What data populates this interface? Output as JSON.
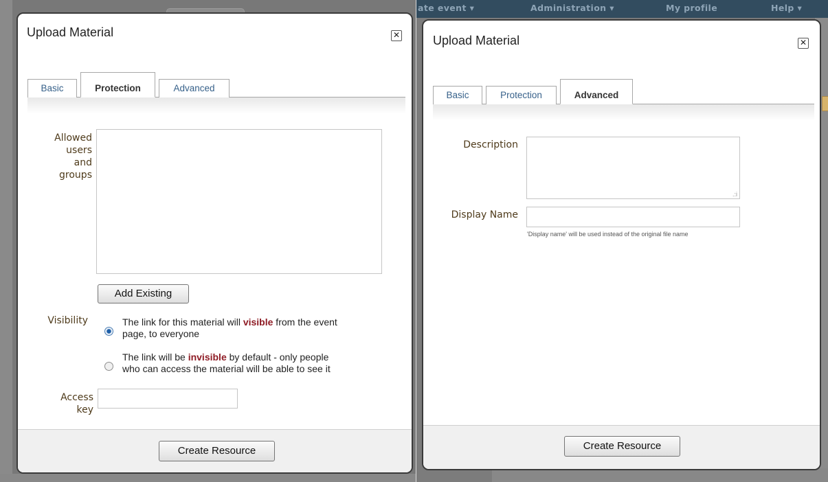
{
  "background_right": {
    "menu": [
      "ate event ▾",
      "Administration ▾",
      "My profile",
      "Help ▾"
    ]
  },
  "left_dialog": {
    "title": "Upload Material",
    "close_glyph": "✕",
    "tabs": [
      {
        "label": "Basic",
        "active": false
      },
      {
        "label": "Protection",
        "active": true
      },
      {
        "label": "Advanced",
        "active": false
      }
    ],
    "allowed_label": [
      "Allowed",
      "users",
      "and",
      "groups"
    ],
    "add_existing_label": "Add Existing",
    "visibility_label": "Visibility",
    "radio_visible": {
      "before": "The link for this material will ",
      "highlight": "visible",
      "after_line1": " from the event",
      "line2": "page, to everyone",
      "checked": true
    },
    "radio_invisible": {
      "before": "The link will be ",
      "highlight": "invisible",
      "after_line1": " by default - only people",
      "line2": "who can access the material will be able to see it",
      "checked": false
    },
    "access_key_label": [
      "Access",
      "key"
    ],
    "access_key_value": "",
    "create_button": "Create Resource"
  },
  "right_dialog": {
    "title": "Upload Material",
    "close_glyph": "✕",
    "tabs": [
      {
        "label": "Basic",
        "active": false
      },
      {
        "label": "Protection",
        "active": false
      },
      {
        "label": "Advanced",
        "active": true
      }
    ],
    "description_label": "Description",
    "description_value": "",
    "display_name_label": "Display Name",
    "display_name_value": "",
    "display_name_hint": "'Display name' will be used instead of the original file name",
    "create_button": "Create Resource"
  }
}
